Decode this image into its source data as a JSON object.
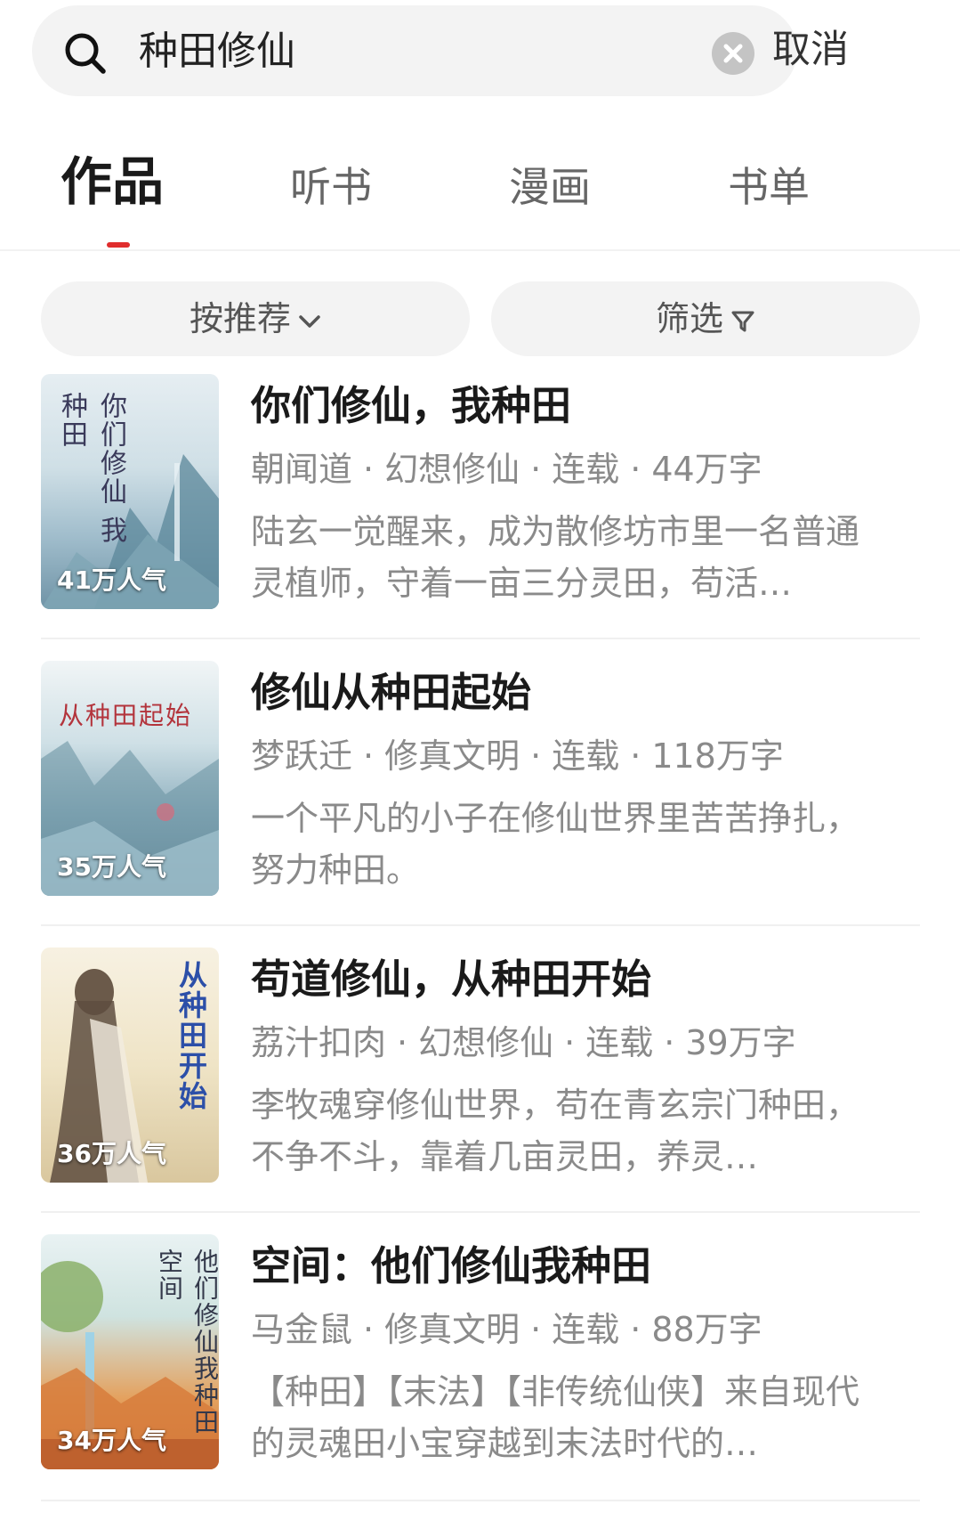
{
  "search": {
    "value": "种田修仙",
    "cancel_label": "取消"
  },
  "tabs": [
    {
      "label": "作品"
    },
    {
      "label": "听书"
    },
    {
      "label": "漫画"
    },
    {
      "label": "书单"
    }
  ],
  "filters": {
    "sort_label": "按推荐",
    "filter_label": "筛选"
  },
  "books": [
    {
      "title": "你们修仙，我种田",
      "author": "朝闻道",
      "genre": "幻想修仙",
      "status": "连载",
      "words": "44万字",
      "description": "陆玄一觉醒来，成为散修坊市里一名普通灵植师，守着一亩三分灵田，苟活…",
      "popularity": "41万人气",
      "cover_text": "你们修仙 我种田"
    },
    {
      "title": "修仙从种田起始",
      "author": "梦跃迁",
      "genre": "修真文明",
      "status": "连载",
      "words": "118万字",
      "description": "一个平凡的小子在修仙世界里苦苦挣扎，努力种田。",
      "popularity": "35万人气",
      "cover_text": "从种田起始"
    },
    {
      "title": "苟道修仙，从种田开始",
      "author": "荔汁扣肉",
      "genre": "幻想修仙",
      "status": "连载",
      "words": "39万字",
      "description": "李牧魂穿修仙世界，苟在青玄宗门种田，不争不斗，靠着几亩灵田，养灵…",
      "popularity": "36万人气",
      "cover_text": "从种田开始"
    },
    {
      "title": "空间：他们修仙我种田",
      "author": "马金鼠",
      "genre": "修真文明",
      "status": "连载",
      "words": "88万字",
      "description": "【种田】【末法】【非传统仙侠】来自现代的灵魂田小宝穿越到末法时代的…",
      "popularity": "34万人气",
      "cover_text": "他们修仙我种田 空间"
    }
  ],
  "meta_separator": "·"
}
